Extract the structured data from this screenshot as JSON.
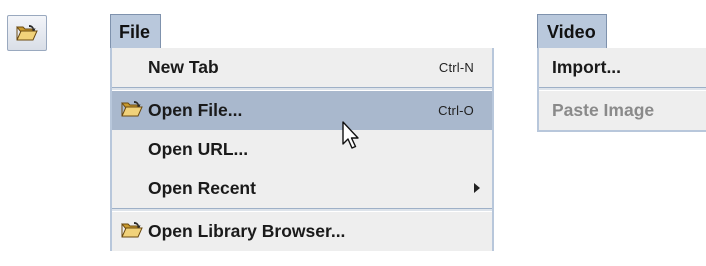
{
  "toolbar": {
    "open_icon": "open-folder-icon"
  },
  "file_menu": {
    "title": "File",
    "items": [
      {
        "label": "New Tab",
        "shortcut": "Ctrl-N"
      },
      {
        "label": "Open File...",
        "shortcut": "Ctrl-O",
        "icon": "open-folder-icon",
        "state": "highlighted"
      },
      {
        "label": "Open URL..."
      },
      {
        "label": "Open Recent",
        "submenu": true
      },
      {
        "label": "Open Library Browser...",
        "icon": "open-folder-icon"
      }
    ]
  },
  "video_menu": {
    "title": "Video",
    "items": [
      {
        "label": "Import..."
      },
      {
        "label": "Paste Image",
        "enabled": false
      }
    ]
  },
  "colors": {
    "menu_title_bg": "#b9c8dc",
    "menu_bg": "#eeeeee",
    "selected_bg": "#a9b8cd",
    "disabled_text": "#8a8a8a"
  }
}
